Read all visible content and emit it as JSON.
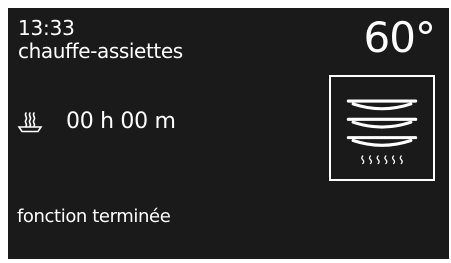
{
  "header": {
    "time": "13:33",
    "mode": "chauffe-assiettes",
    "temperature": "60°"
  },
  "timer": {
    "icon": "heat-plate-icon",
    "value": "00 h 00 m"
  },
  "program": {
    "icon": "stacked-plates-heat-icon"
  },
  "status": {
    "message": "fonction terminée"
  },
  "colors": {
    "background": "#1a1a1a",
    "foreground": "#ffffff"
  }
}
